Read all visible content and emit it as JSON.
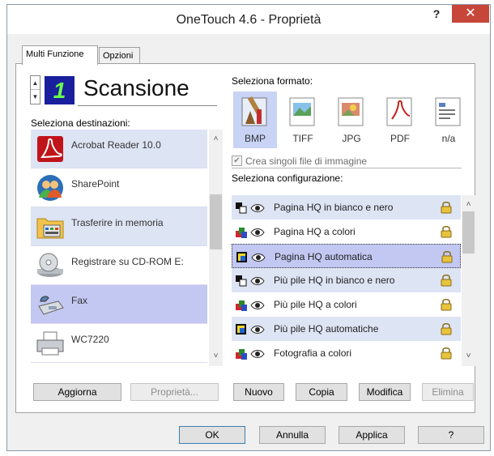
{
  "window": {
    "title": "OneTouch 4.6 - Proprietà",
    "help": "?",
    "close": "✕"
  },
  "tabs": [
    {
      "label": "Multi Funzione"
    },
    {
      "label": "Opzioni"
    }
  ],
  "selector": {
    "up": "▲",
    "down": "▼",
    "number": "1",
    "title": "Scansione"
  },
  "destinations": {
    "label": "Seleziona destinazioni:",
    "items": [
      {
        "label": "Acrobat Reader 10.0",
        "icon": "acrobat-icon"
      },
      {
        "label": "SharePoint",
        "icon": "sharepoint-icon"
      },
      {
        "label": "Trasferire in memoria",
        "icon": "folder-icon"
      },
      {
        "label": "Registrare su CD-ROM  E:",
        "icon": "cd-rom-icon"
      },
      {
        "label": "Fax",
        "icon": "fax-icon"
      },
      {
        "label": "WC7220",
        "icon": "printer-icon"
      }
    ],
    "selected": "Fax"
  },
  "formats": {
    "label": "Seleziona formato:",
    "items": [
      {
        "label": "BMP",
        "icon": "bmp-icon"
      },
      {
        "label": "TIFF",
        "icon": "tiff-icon"
      },
      {
        "label": "JPG",
        "icon": "jpg-icon"
      },
      {
        "label": "PDF",
        "icon": "pdf-icon"
      },
      {
        "label": "n/a",
        "icon": "na-icon"
      }
    ],
    "selected": "BMP",
    "single_files": "Crea singoli file di immagine"
  },
  "configurations": {
    "label": "Seleziona configurazione:",
    "items": [
      {
        "label": "Pagina HQ in bianco e nero",
        "mode": "bw"
      },
      {
        "label": "Pagina HQ a colori",
        "mode": "color"
      },
      {
        "label": "Pagina HQ automatica",
        "mode": "auto"
      },
      {
        "label": "Più pile  HQ in bianco e nero",
        "mode": "bw"
      },
      {
        "label": "Più pile  HQ a colori",
        "mode": "color"
      },
      {
        "label": "Più pile  HQ automatiche",
        "mode": "auto"
      },
      {
        "label": "Fotografia a colori",
        "mode": "color"
      }
    ],
    "selected": "Pagina HQ automatica"
  },
  "buttons": {
    "aggiorna": "Aggiorna",
    "proprieta": "Proprietà...",
    "nuovo": "Nuovo",
    "copia": "Copia",
    "modifica": "Modifica",
    "elimina": "Elimina",
    "ok": "OK",
    "annulla": "Annulla",
    "applica": "Applica",
    "help": "?"
  },
  "colors": {
    "close": "#c7463a",
    "selection": "#c2c8f2",
    "alt_row": "#dde4f4",
    "format_selected": "#c8d3f5"
  }
}
